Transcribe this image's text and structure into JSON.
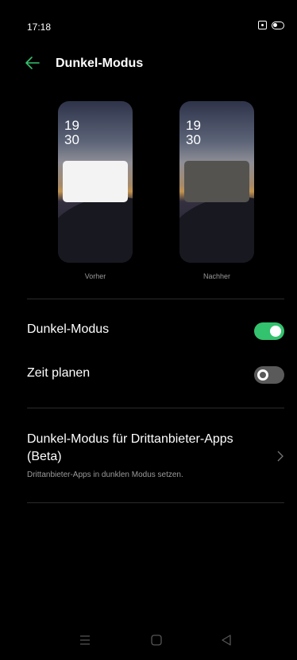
{
  "status_bar": {
    "time": "17:18",
    "icons": [
      "nfc-icon",
      "battery-icon"
    ]
  },
  "header": {
    "back_icon": "arrow-left-icon",
    "title": "Dunkel-Modus"
  },
  "preview": {
    "before": {
      "clock_hour": "19",
      "clock_minute": "30",
      "label": "Vorher"
    },
    "after": {
      "clock_hour": "19",
      "clock_minute": "30",
      "label": "Nachher"
    }
  },
  "settings": {
    "dark_mode": {
      "label": "Dunkel-Modus",
      "enabled": true
    },
    "schedule": {
      "label": "Zeit planen",
      "enabled": false
    }
  },
  "third_party": {
    "title": "Dunkel-Modus für Drittanbieter-Apps (Beta)",
    "subtitle": "Drittanbieter-Apps in dunklen Modus setzen.",
    "chevron_icon": "chevron-right-icon"
  },
  "nav_bar": {
    "icons": [
      "menu-icon",
      "home-icon",
      "back-icon"
    ]
  },
  "colors": {
    "accent": "#33c26d",
    "background": "#000000",
    "toggle_off": "#5a5a5a"
  }
}
